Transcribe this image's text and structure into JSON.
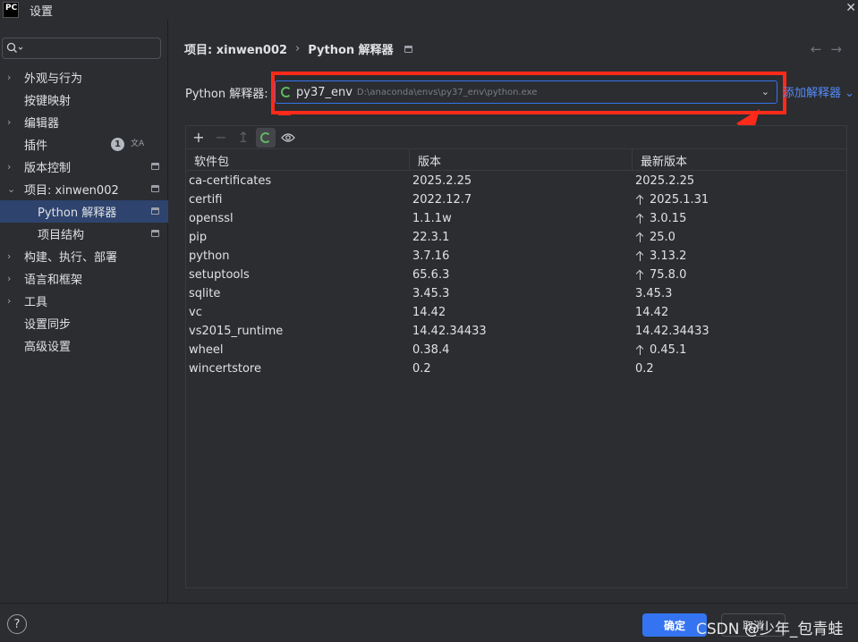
{
  "window": {
    "app_icon_text": "PC",
    "title": "设置",
    "close_glyph": "✕"
  },
  "sidebar": {
    "search_placeholder": "",
    "items": [
      {
        "label": "外观与行为",
        "expandable": true
      },
      {
        "label": "按键映射",
        "expandable": false
      },
      {
        "label": "编辑器",
        "expandable": true
      },
      {
        "label": "插件",
        "expandable": false,
        "badge": "1"
      },
      {
        "label": "版本控制",
        "expandable": true
      },
      {
        "label": "项目: xinwen002",
        "expandable": true,
        "expanded": true
      },
      {
        "label": "Python 解释器",
        "child": true,
        "selected": true
      },
      {
        "label": "项目结构",
        "child": true
      },
      {
        "label": "构建、执行、部署",
        "expandable": true
      },
      {
        "label": "语言和框架",
        "expandable": true
      },
      {
        "label": "工具",
        "expandable": true
      },
      {
        "label": "设置同步",
        "expandable": false
      },
      {
        "label": "高级设置",
        "expandable": false
      }
    ]
  },
  "breadcrumb": {
    "project": "项目: xinwen002",
    "separator": "›",
    "page": "Python 解释器"
  },
  "nav": {
    "back": "←",
    "forward": "→"
  },
  "interpreter": {
    "label": "Python 解释器:",
    "name": "py37_env",
    "path": "D:\\anaconda\\envs\\py37_env\\python.exe",
    "add_label": "添加解释器",
    "add_chevron": "⌄"
  },
  "toolbar": {
    "add": "+",
    "remove": "−",
    "upgrade": "↥",
    "show": "◉"
  },
  "table": {
    "columns": [
      "软件包",
      "版本",
      "最新版本"
    ],
    "rows": [
      {
        "package": "ca-certificates",
        "version": "2025.2.25",
        "latest": "2025.2.25",
        "upgrade": false
      },
      {
        "package": "certifi",
        "version": "2022.12.7",
        "latest": "2025.1.31",
        "upgrade": true
      },
      {
        "package": "openssl",
        "version": "1.1.1w",
        "latest": "3.0.15",
        "upgrade": true
      },
      {
        "package": "pip",
        "version": "22.3.1",
        "latest": "25.0",
        "upgrade": true
      },
      {
        "package": "python",
        "version": "3.7.16",
        "latest": "3.13.2",
        "upgrade": true
      },
      {
        "package": "setuptools",
        "version": "65.6.3",
        "latest": "75.8.0",
        "upgrade": true
      },
      {
        "package": "sqlite",
        "version": "3.45.3",
        "latest": "3.45.3",
        "upgrade": false
      },
      {
        "package": "vc",
        "version": "14.42",
        "latest": "14.42",
        "upgrade": false
      },
      {
        "package": "vs2015_runtime",
        "version": "14.42.34433",
        "latest": "14.42.34433",
        "upgrade": false
      },
      {
        "package": "wheel",
        "version": "0.38.4",
        "latest": "0.45.1",
        "upgrade": true
      },
      {
        "package": "wincertstore",
        "version": "0.2",
        "latest": "0.2",
        "upgrade": false
      }
    ]
  },
  "footer": {
    "help": "?",
    "ok": "确定",
    "cancel": "取消",
    "watermark": "CSDN @少年_包青蛙"
  },
  "colors": {
    "accent": "#3574f0",
    "highlight": "#ff2a1a",
    "link": "#548af7"
  }
}
